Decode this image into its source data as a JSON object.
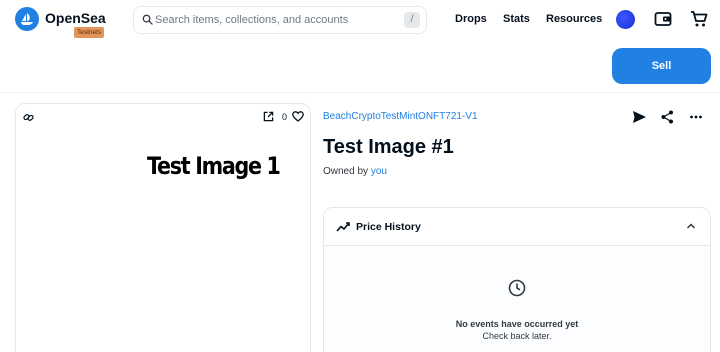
{
  "header": {
    "brand": "OpenSea",
    "badge": "Testnets",
    "search_placeholder": "Search items, collections, and accounts",
    "search_shortcut": "/",
    "nav": [
      "Drops",
      "Stats",
      "Resources"
    ]
  },
  "actions": {
    "sell_label": "Sell"
  },
  "media": {
    "favorite_count": "0",
    "image_text": "Test Image 1"
  },
  "item": {
    "collection": "BeachCryptoTestMintONFT721-V1",
    "title": "Test Image #1",
    "owned_by_prefix": "Owned by",
    "owner": "you"
  },
  "price_history": {
    "title": "Price History",
    "empty_title": "No events have occurred yet",
    "empty_subtitle": "Check back later."
  },
  "colors": {
    "accent": "#2081e2",
    "badge": "#e2955a",
    "text": "#04111d"
  }
}
